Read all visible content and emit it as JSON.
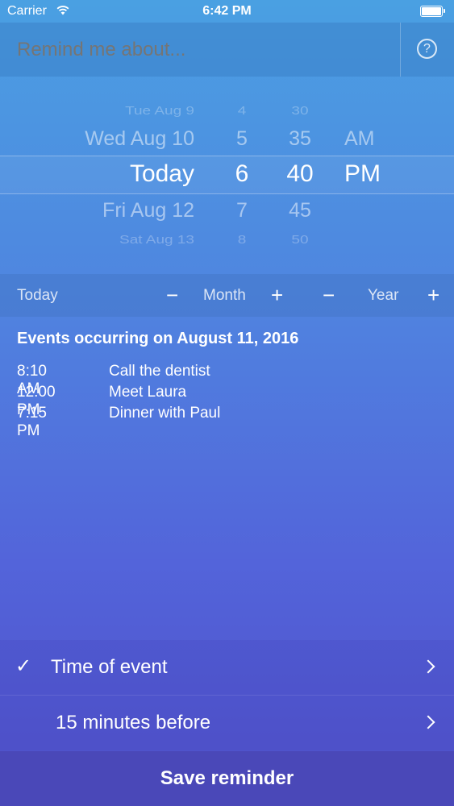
{
  "status_bar": {
    "carrier": "Carrier",
    "time": "6:42 PM"
  },
  "header": {
    "placeholder": "Remind me about...",
    "help_icon": "?"
  },
  "picker": {
    "dates": [
      "Tue Aug 9",
      "Wed Aug 10",
      "Today",
      "Fri Aug 12",
      "Sat Aug 13"
    ],
    "hours": [
      "4",
      "5",
      "6",
      "7",
      "8"
    ],
    "minutes": [
      "30",
      "35",
      "40",
      "45",
      "50"
    ],
    "ampm": [
      "AM",
      "PM"
    ],
    "selected": {
      "date": "Today",
      "hour": "6",
      "minute": "40",
      "ampm": "PM"
    }
  },
  "nav": {
    "today": "Today",
    "minus": "−",
    "plus": "+",
    "month": "Month",
    "year": "Year"
  },
  "events": {
    "title": "Events occurring on August 11, 2016",
    "items": [
      {
        "time": "8:10 AM",
        "name": "Call the dentist"
      },
      {
        "time": "12:00 PM",
        "name": "Meet Laura"
      },
      {
        "time": "7:15 PM",
        "name": "Dinner with Paul"
      }
    ]
  },
  "options": [
    {
      "label": "Time of event",
      "checked": true
    },
    {
      "label": "15 minutes before",
      "checked": false
    }
  ],
  "check_glyph": "✓",
  "save_label": "Save reminder"
}
